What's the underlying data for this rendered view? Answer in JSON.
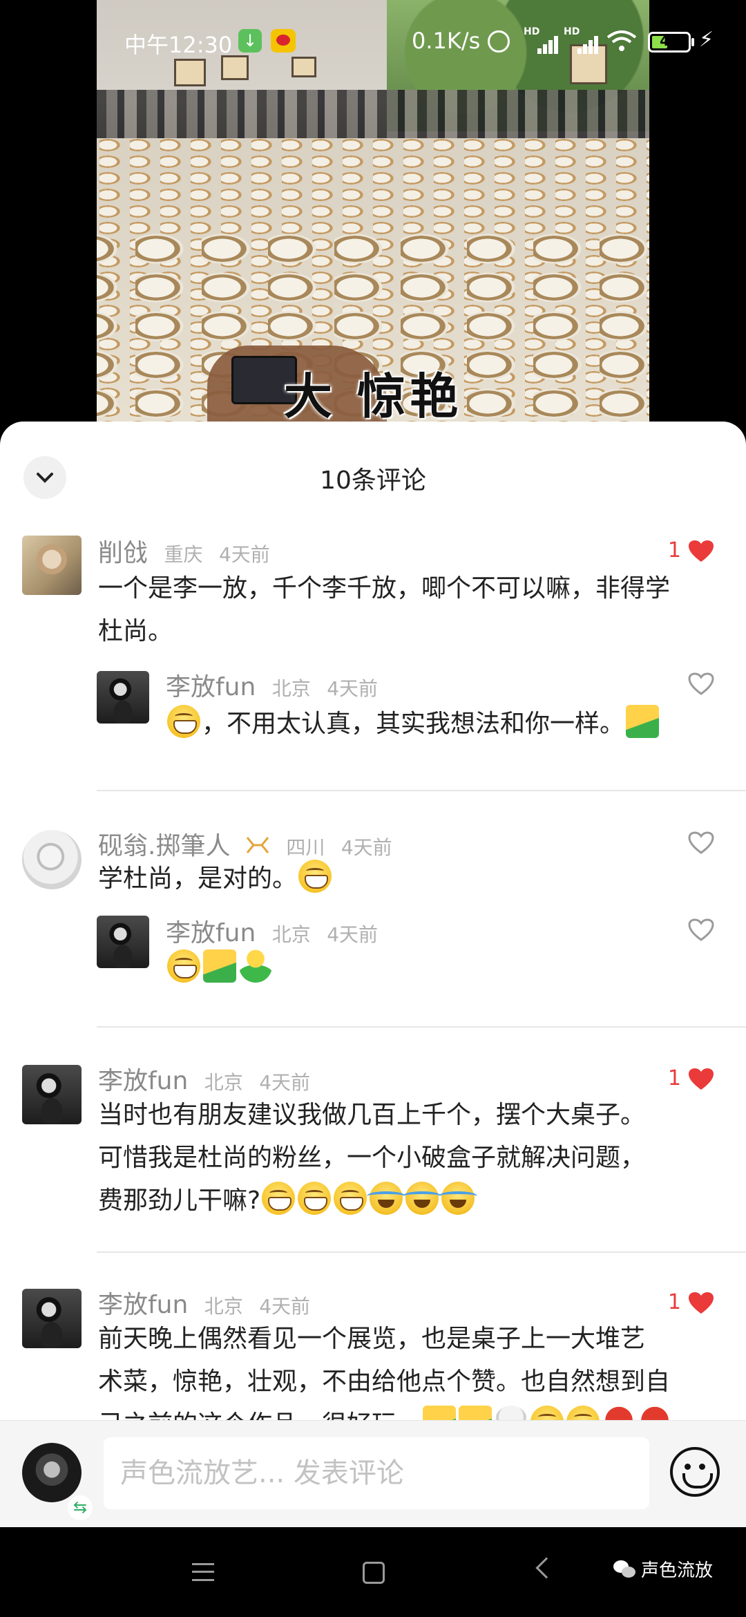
{
  "status_bar": {
    "time": "中午12:30",
    "net_speed": "0.1K/s",
    "hd1": "HD",
    "hd2": "HD",
    "battery_level": "41",
    "icons": [
      "download-icon",
      "weibo-icon",
      "alarm-icon",
      "signal-icon",
      "signal-icon",
      "wifi-icon",
      "battery-icon",
      "charging-icon"
    ]
  },
  "video": {
    "subtitle": "大 惊艳"
  },
  "comments_sheet": {
    "title": "10条评论",
    "collapse_icon": "chevron-down-icon",
    "like_color": "#ea3a3a",
    "comments": [
      {
        "user": "削戗",
        "location": "重庆",
        "time": "4天前",
        "likes": "1",
        "liked": true,
        "text_line1": "一个是李一放，千个李千放，唧个不可以嘛，非得学",
        "text_line2": "杜尚。",
        "reply": {
          "user": "李放fun",
          "location": "北京",
          "time": "4天前",
          "text": "，不用太认真，其实我想法和你一样。"
        }
      },
      {
        "user": "砚翁.掷筆人",
        "location": "四川",
        "time": "4天前",
        "text": "学杜尚，是对的。",
        "reply": {
          "user": "李放fun",
          "location": "北京",
          "time": "4天前"
        }
      },
      {
        "user": "李放fun",
        "location": "北京",
        "time": "4天前",
        "likes": "1",
        "liked": true,
        "text_line1": "当时也有朋友建议我做几百上千个，摆个大桌子。",
        "text_line2": "可惜我是杜尚的粉丝，一个小破盒子就解决问题，",
        "text_line3": "费那劲儿干嘛?"
      },
      {
        "user": "李放fun",
        "location": "北京",
        "time": "4天前",
        "likes": "1",
        "liked": true,
        "text_line1": "前天晚上偶然看见一个展览，也是桌子上一大堆艺",
        "text_line2": "术菜，惊艳，壮观，不由给他点个赞。也自然想到自",
        "text_line3": "己之前的这个作品，很好玩。"
      }
    ]
  },
  "input_bar": {
    "placeholder": "声色流放艺... 发表评论",
    "swap_symbol": "⇆"
  },
  "nav_bar": {
    "watermark": "声色流放"
  }
}
